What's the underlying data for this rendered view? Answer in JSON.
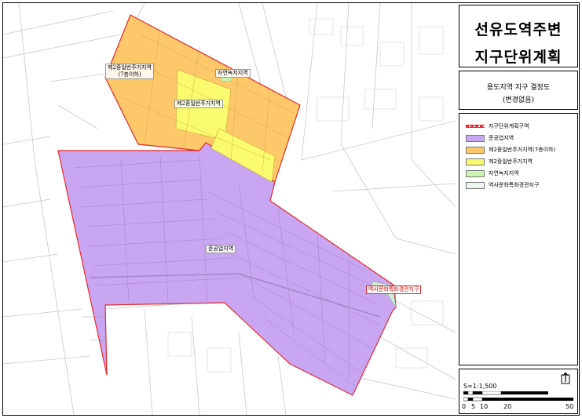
{
  "title": {
    "line1": "선유도역주변",
    "line2": "지구단위계획"
  },
  "subtitle": {
    "line1": "용도지역 지구 결정도",
    "line2": "(변경없음)"
  },
  "legend": [
    {
      "label": "지구단위계획구역",
      "color": "#e8282b"
    },
    {
      "label": "준공업지역",
      "color": "#c9a6f2"
    },
    {
      "label": "제2종일반주거지역(7층이하)",
      "color": "#fcc86a"
    },
    {
      "label": "제2종일반주거지역",
      "color": "#fafa6e"
    },
    {
      "label": "자연녹지지역",
      "color": "#ccf5b2"
    },
    {
      "label": "역사문화특화경관지구",
      "color": "#eef7ef"
    }
  ],
  "map_labels": {
    "res7": "제2종일반주거지역",
    "res7_sub": "(7층이하)",
    "green": "자연녹지지역",
    "res2": "제2종일반주거지역",
    "industrial": "준공업지역",
    "heritage": "역사문화특화경관지구"
  },
  "scale": {
    "label": "S=1:1,500",
    "ticks": [
      "0",
      "5",
      "10",
      "20",
      "50"
    ]
  }
}
